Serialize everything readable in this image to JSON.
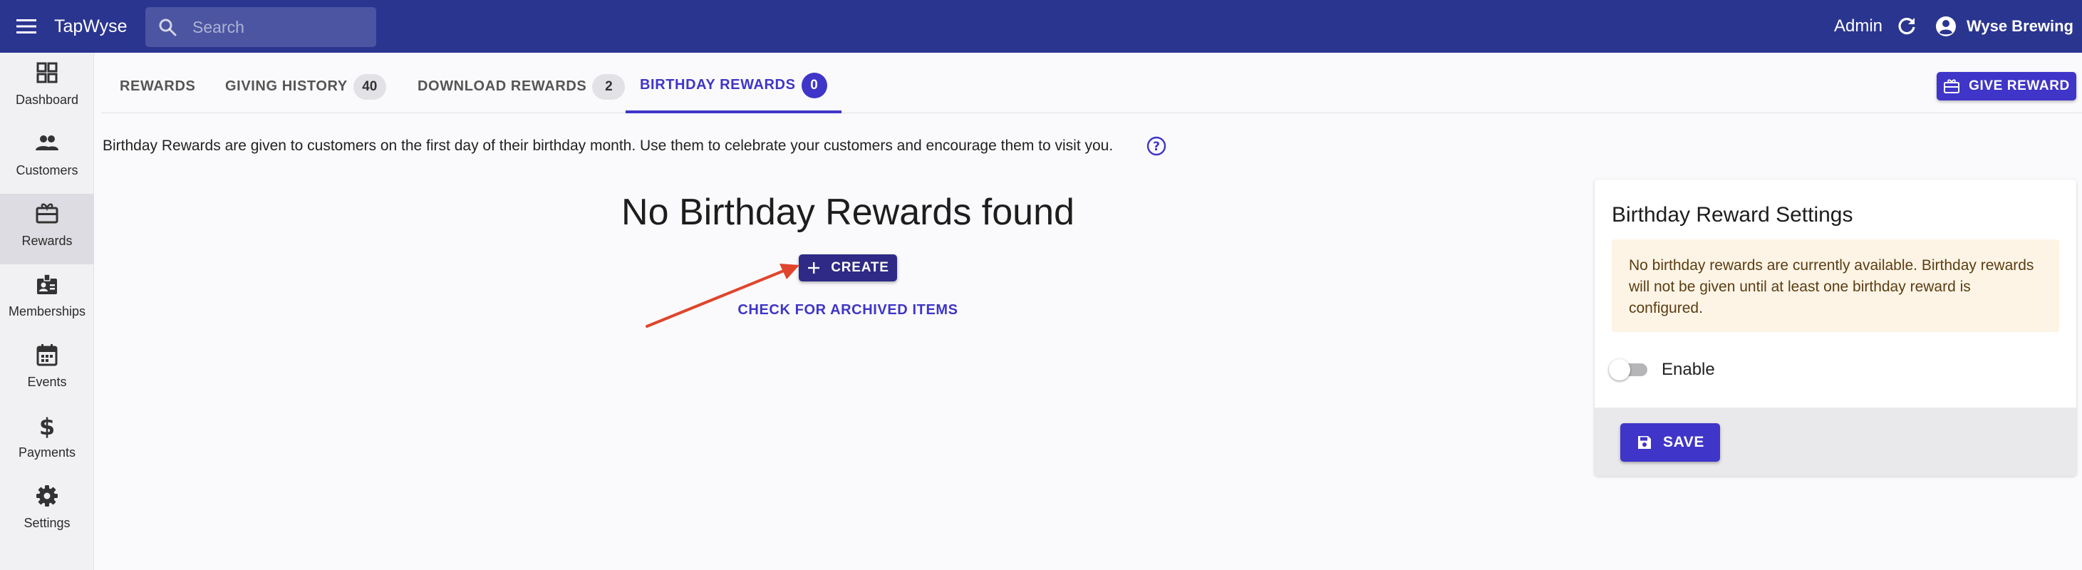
{
  "topbar": {
    "brand": "TapWyse",
    "search_placeholder": "Search",
    "admin_label": "Admin",
    "account_name": "Wyse Brewing",
    "background": "#2a3590"
  },
  "sidebar": {
    "items": [
      {
        "label": "Dashboard",
        "icon": "dashboard-icon"
      },
      {
        "label": "Customers",
        "icon": "people-icon"
      },
      {
        "label": "Rewards",
        "icon": "gift-card-icon",
        "active": true
      },
      {
        "label": "Memberships",
        "icon": "badge-icon"
      },
      {
        "label": "Events",
        "icon": "calendar-icon"
      },
      {
        "label": "Payments",
        "icon": "dollar-icon"
      },
      {
        "label": "Settings",
        "icon": "gear-icon"
      }
    ]
  },
  "tabs": [
    {
      "label": "REWARDS"
    },
    {
      "label": "GIVING HISTORY",
      "badge": "40"
    },
    {
      "label": "DOWNLOAD REWARDS",
      "badge": "2"
    },
    {
      "label": "BIRTHDAY REWARDS",
      "badge": "0",
      "active": true
    }
  ],
  "give_reward_label": "GIVE REWARD",
  "description": "Birthday Rewards are given to customers on the first day of their birthday month. Use them to celebrate your customers and encourage them to visit you.",
  "empty_state": {
    "title": "No Birthday Rewards found",
    "create_label": "CREATE",
    "archived_label": "CHECK FOR ARCHIVED ITEMS"
  },
  "settings_card": {
    "title": "Birthday Reward Settings",
    "alert": "No birthday rewards are currently available. Birthday rewards will not be given until at least one birthday reward is configured.",
    "toggle_label": "Enable",
    "toggle_on": false,
    "save_label": "SAVE"
  },
  "colors": {
    "accent": "#3f35c8",
    "annotation_arrow": "#e0452b",
    "alert_bg": "#fdf4e6"
  }
}
